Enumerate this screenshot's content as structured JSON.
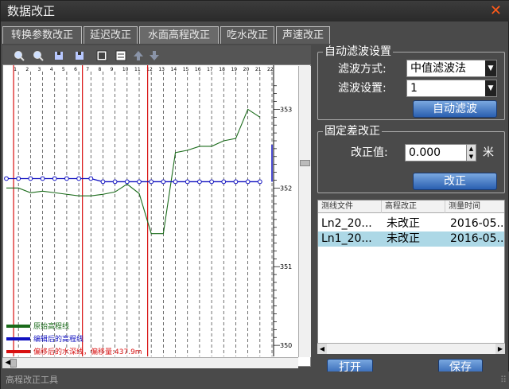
{
  "window": {
    "title": "数据改正"
  },
  "tabs": [
    {
      "label": "转换参数改正"
    },
    {
      "label": "延迟改正"
    },
    {
      "label": "水面高程改正",
      "active": true
    },
    {
      "label": "吃水改正"
    },
    {
      "label": "声速改正"
    }
  ],
  "toolbar": {
    "icons": [
      "zoom-in-icon",
      "zoom-out-icon",
      "first-icon",
      "last-icon",
      "select-icon",
      "list-icon",
      "up-arrow-icon",
      "down-arrow-icon"
    ]
  },
  "plot": {
    "top_ticks": [
      "1",
      "2",
      "3",
      "4",
      "5",
      "6",
      "7",
      "8",
      "9",
      "10",
      "11",
      "12",
      "13",
      "14",
      "15",
      "16",
      "17",
      "18",
      "19",
      "20",
      "21",
      "22"
    ],
    "right_ticks": [
      "353",
      "352",
      "351",
      "350"
    ],
    "legend": [
      {
        "label": "原始高程线",
        "color": "#1a6b1a"
      },
      {
        "label": "编辑后的高程线",
        "color": "#1010c0"
      },
      {
        "label": "偏移后的水深线，偏移量:437.9m",
        "color": "#d81010"
      }
    ],
    "chart_data": {
      "type": "line",
      "x": [
        0,
        1,
        2,
        3,
        4,
        5,
        6,
        7,
        8,
        9,
        10,
        11,
        12,
        13,
        14,
        15,
        16,
        17,
        18,
        19,
        20,
        21,
        22
      ],
      "series": [
        {
          "name": "原始高程线",
          "values": [
            352.0,
            352.0,
            351.94,
            351.96,
            351.94,
            351.92,
            351.9,
            351.9,
            351.92,
            351.95,
            352.05,
            351.93,
            351.42,
            351.42,
            352.45,
            352.48,
            352.53,
            352.53,
            352.6,
            352.63,
            353.0,
            352.9
          ]
        },
        {
          "name": "编辑后的高程线",
          "values": [
            352.12,
            352.12,
            352.12,
            352.12,
            352.12,
            352.12,
            352.12,
            352.12,
            352.08,
            352.08,
            352.08,
            352.08,
            352.08,
            352.08,
            352.08,
            352.08,
            352.08,
            352.08,
            352.08,
            352.08,
            352.08,
            352.08
          ]
        }
      ],
      "ylim": [
        349.9,
        353.5
      ]
    }
  },
  "auto_filter": {
    "title": "自动滤波设置",
    "method_label": "滤波方式:",
    "method_value": "中值滤波法",
    "setting_label": "滤波设置:",
    "setting_value": "1",
    "button": "自动滤波"
  },
  "fixed_correction": {
    "title": "固定差改正",
    "value_label": "改正值:",
    "value": "0.000",
    "unit": "米",
    "button": "改正"
  },
  "file_table": {
    "columns": [
      "测线文件",
      "高程改正",
      "测量时间"
    ],
    "rows": [
      {
        "file": "Ln2_20...",
        "status": "未改正",
        "time": "2016-05..."
      },
      {
        "file": "Ln1_20...",
        "status": "未改正",
        "time": "2016-05...",
        "selected": true
      }
    ]
  },
  "buttons": {
    "open": "打开",
    "save": "保存"
  },
  "statusbar": {
    "text": "高程改正工具"
  },
  "colors": {
    "accent": "#2a5fb0",
    "close": "#ff5a1a"
  }
}
